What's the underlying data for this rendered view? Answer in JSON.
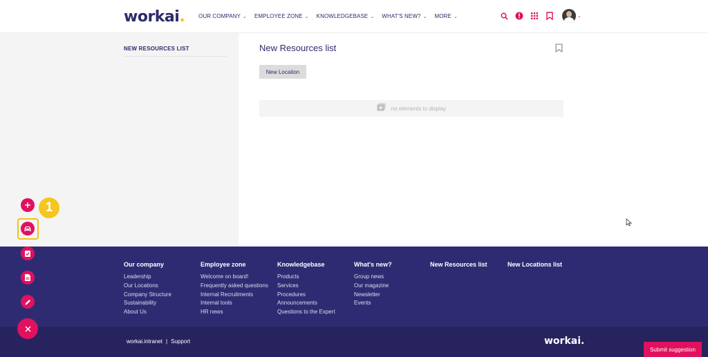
{
  "header": {
    "logo": "workai",
    "logo_dot": ".",
    "nav": [
      {
        "label": "OUR COMPANY"
      },
      {
        "label": "EMPLOYEE ZONE"
      },
      {
        "label": "KNOWLEDGEBASE"
      },
      {
        "label": "WHAT'S NEW?"
      },
      {
        "label": "MORE"
      }
    ]
  },
  "sidebar": {
    "title": "NEW RESOURCES LIST"
  },
  "main": {
    "title": "New Resources list",
    "new_location_button": "New Location",
    "empty_text": "no elements to display"
  },
  "footer": {
    "columns": [
      {
        "heading": "Our company",
        "links": [
          "Leadership",
          "Our Locations",
          "Company Structure",
          "Sustainability",
          "About Us"
        ]
      },
      {
        "heading": "Employee zone",
        "links": [
          "Welcome on board!",
          "Frequently asked questions",
          "Internal Recruitments",
          "Internal tools",
          "HR news"
        ]
      },
      {
        "heading": "Knowledgebase",
        "links": [
          "Products",
          "Services",
          "Procedures",
          "Announcements",
          "Questions to the Expert"
        ]
      },
      {
        "heading": "What's new?",
        "links": [
          "Group news",
          "Our magazine",
          "Newsletter",
          "Events"
        ]
      },
      {
        "heading": "New Resources list",
        "links": []
      },
      {
        "heading": "New Locations list",
        "links": []
      }
    ],
    "bottom_link_1": "workai.intranet",
    "bottom_separator": "|",
    "bottom_link_2": "Support",
    "logo": "workai."
  },
  "submit_button": "Submit suggestion",
  "step_badge": "1",
  "colors": {
    "primary": "#2e2a6b",
    "accent": "#e0115f",
    "highlight": "#f2c312",
    "footer": "#2f2b73"
  }
}
